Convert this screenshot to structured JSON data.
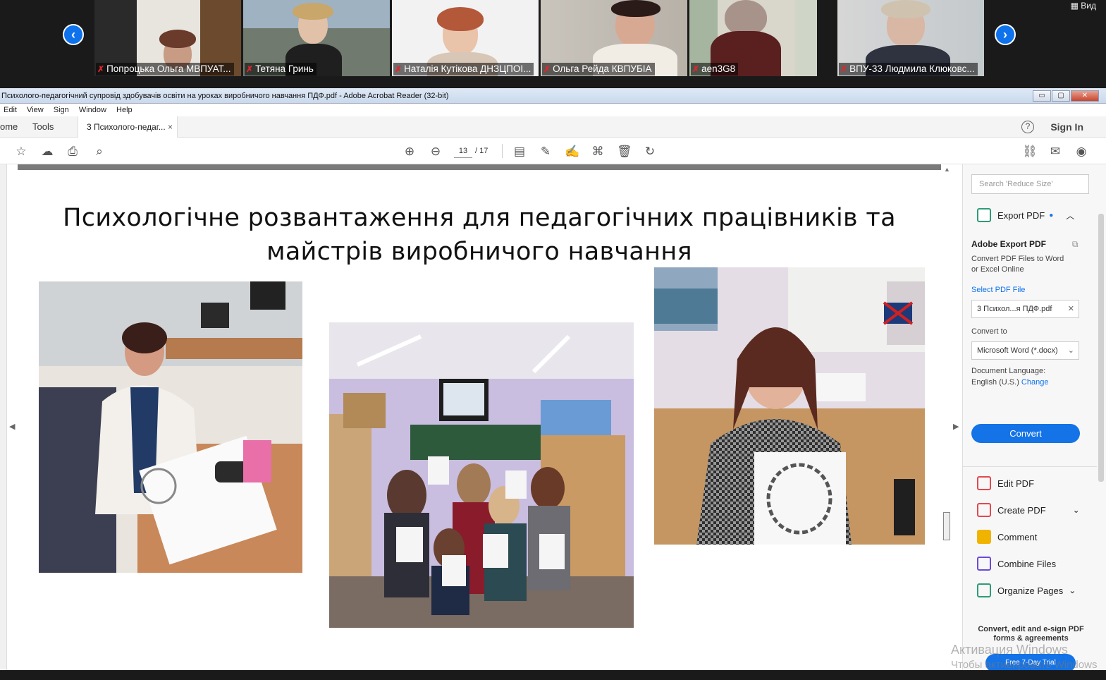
{
  "zoom": {
    "view_label": "▦ Вид",
    "participants": [
      {
        "name": "Попроцька Ольга МВПУАТ..."
      },
      {
        "name": "Тетяна Гринь"
      },
      {
        "name": "Наталія Кутікова ДНЗЦПОІ..."
      },
      {
        "name": "Ольга Рейда КВПУБІА"
      },
      {
        "name": "aen3G8"
      },
      {
        "name": "ВПУ-33 Людмила Клюковс..."
      }
    ]
  },
  "window": {
    "title": "Психолого-педагогічний супровід здобувачів освіти на уроках виробничого навчання ПДФ.pdf - Adobe Acrobat Reader (32-bit)",
    "buttons": {
      "minimize": "▭",
      "maximize": "▢",
      "close": "✕"
    }
  },
  "menu": [
    "Edit",
    "View",
    "Sign",
    "Window",
    "Help"
  ],
  "tabs": {
    "home": "ome",
    "tools": "Tools",
    "doc": "3 Психолого-педаг...",
    "doc_close": "×"
  },
  "header": {
    "help": "?",
    "sign_in": "Sign In"
  },
  "toolbar": {
    "page_current": "13",
    "page_total": "/ 17"
  },
  "slide": {
    "title_line1": "Психологічне розвантаження для педагогічних працівників та",
    "title_line2": "майстрів виробничого навчання"
  },
  "right_panel": {
    "search_placeholder": "Search 'Reduce Size'",
    "export_pdf": "Export PDF",
    "adobe_export_title": "Adobe Export PDF",
    "adobe_export_desc1": "Convert PDF Files to Word",
    "adobe_export_desc2": "or Excel Online",
    "select_file_label": "Select PDF File",
    "selected_file": "3 Психол...я ПДФ.pdf",
    "convert_to_label": "Convert to",
    "convert_to_value": "Microsoft Word (*.docx)",
    "doc_lang_label": "Document Language:",
    "doc_lang_value": "English (U.S.)",
    "change_link": "Change",
    "convert_button": "Convert",
    "tools": [
      {
        "label": "Edit PDF",
        "color": "#e34850"
      },
      {
        "label": "Create PDF",
        "color": "#e34850"
      },
      {
        "label": "Comment",
        "color": "#f0b400"
      },
      {
        "label": "Combine Files",
        "color": "#6c4ad8"
      },
      {
        "label": "Organize Pages",
        "color": "#2d9d78"
      }
    ],
    "bottom_text1": "Convert, edit and e-sign PDF",
    "bottom_text2": "forms & agreements",
    "trial_button": "Free 7-Day Trial"
  },
  "watermark": {
    "line1": "Активация Windows",
    "line2": "Чтобы активировать Windows"
  }
}
